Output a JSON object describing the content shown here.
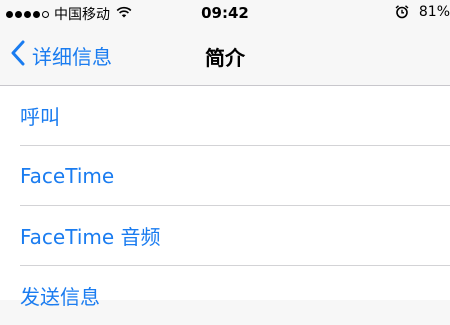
{
  "status_bar": {
    "carrier": "中国移动",
    "time": "09:42",
    "battery": "81%",
    "signal_icon": "signal-dots-icon",
    "wifi_icon": "wifi-icon",
    "alarm_icon": "alarm-icon"
  },
  "nav": {
    "back_label": "详细信息",
    "title": "简介",
    "back_icon": "chevron-left-icon"
  },
  "list": {
    "items": [
      {
        "label": "呼叫"
      },
      {
        "label": "FaceTime"
      },
      {
        "label": "FaceTime 音频"
      },
      {
        "label": "发送信息"
      }
    ]
  },
  "colors": {
    "accent": "#1a7cf0",
    "background": "#f7f7f7",
    "separator": "#d3d3d6"
  }
}
